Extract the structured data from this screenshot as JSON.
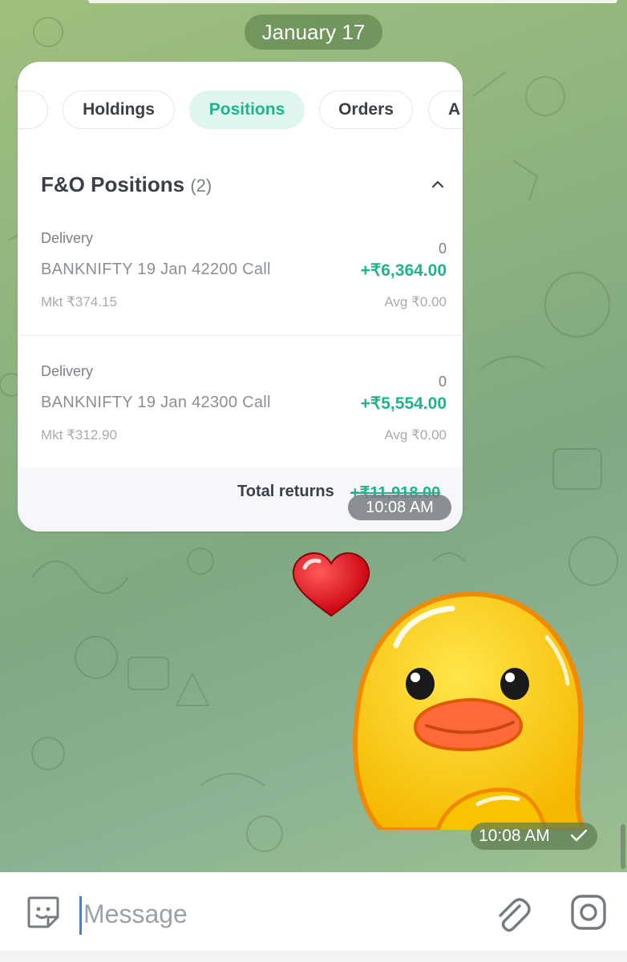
{
  "chat": {
    "date_separator": "January 17",
    "image_message_time": "10:08 AM",
    "sticker_time": "10:08 AM"
  },
  "screenshot_card": {
    "tabs": [
      {
        "label": ""
      },
      {
        "label": "Holdings"
      },
      {
        "label": "Positions",
        "active": true
      },
      {
        "label": "Orders"
      },
      {
        "label": "A"
      }
    ],
    "section": {
      "title": "F&O Positions",
      "count": "(2)"
    },
    "positions": [
      {
        "type": "Delivery",
        "qty": "0",
        "name": "BANKNIFTY 19 Jan 42200 Call",
        "pnl": "+₹6,364.00",
        "mkt": "Mkt ₹374.15",
        "avg": "Avg ₹0.00"
      },
      {
        "type": "Delivery",
        "qty": "0",
        "name": "BANKNIFTY 19 Jan 42300 Call",
        "pnl": "+₹5,554.00",
        "mkt": "Mkt ₹312.90",
        "avg": "Avg ₹0.00"
      }
    ],
    "total_label": "Total returns",
    "total_value": "+₹11,918.00"
  },
  "composer": {
    "placeholder": "Message"
  },
  "icons": {
    "emoji": "sticker-icon",
    "attach": "paperclip-icon",
    "camera": "instagram-camera-icon",
    "sent": "check-icon"
  },
  "colors": {
    "accent_green": "#21b48a",
    "active_tab_bg": "#e0f5ef"
  }
}
